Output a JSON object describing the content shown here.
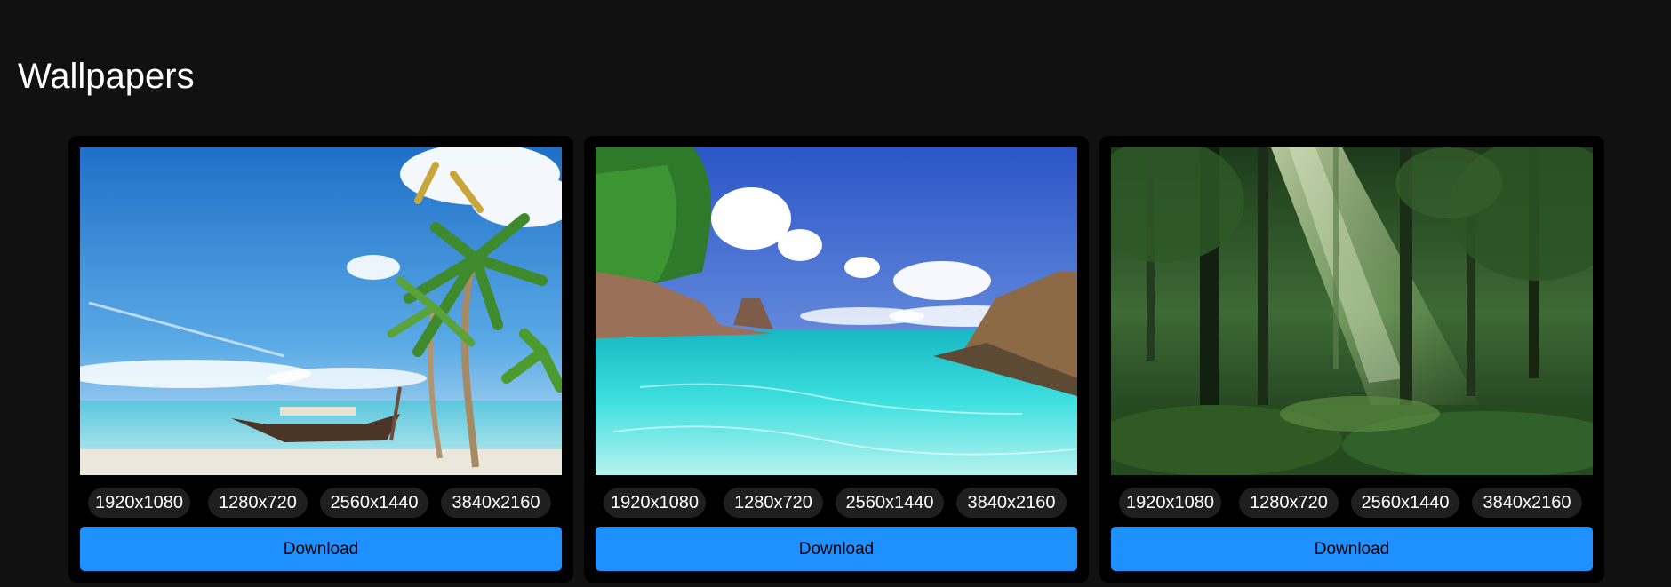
{
  "page": {
    "title": "Wallpapers"
  },
  "colors": {
    "background": "#111111",
    "card": "#000000",
    "resolution_pill": "#1f1f1f",
    "download_button": "#1e90ff"
  },
  "wallpapers": [
    {
      "image": "tropical-beach-with-palm-trees-and-longtail-boat",
      "resolutions": [
        "1920x1080",
        "1280x720",
        "2560x1440",
        "3840x2160"
      ],
      "download_label": "Download"
    },
    {
      "image": "turquoise-lagoon-with-rocky-islands",
      "resolutions": [
        "1920x1080",
        "1280x720",
        "2560x1440",
        "3840x2160"
      ],
      "download_label": "Download"
    },
    {
      "image": "sunlit-green-forest",
      "resolutions": [
        "1920x1080",
        "1280x720",
        "2560x1440",
        "3840x2160"
      ],
      "download_label": "Download"
    }
  ]
}
